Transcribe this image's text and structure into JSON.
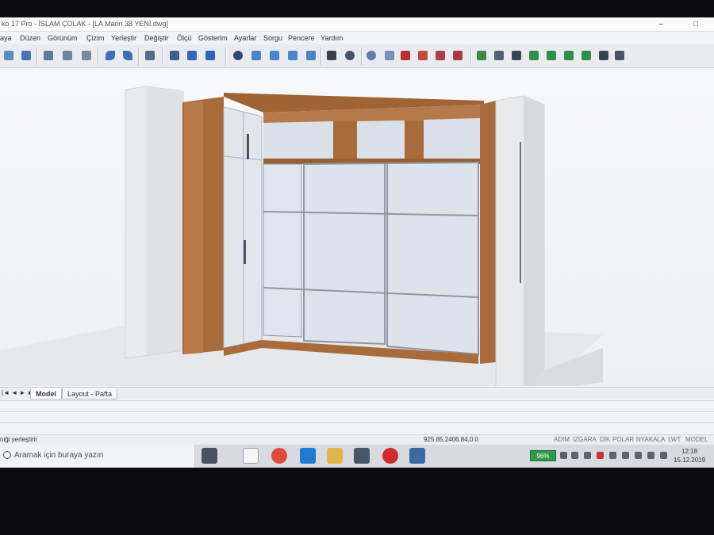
{
  "window": {
    "title": "ko 17 Pro - İSLAM ÇOLAK - [LA Marin 38 YENİ.dwg]",
    "controls": [
      "–",
      "□"
    ]
  },
  "menu": [
    "aya",
    "Düzen",
    "Görünüm",
    "Çizim",
    "Yerleştir",
    "Değiştir",
    "Ölçü",
    "Gösterim",
    "Ayarlar",
    "Sorgu",
    "Pencere",
    "Yardım"
  ],
  "toolbar_icons": [
    "open-icon",
    "save-icon",
    "print-icon",
    "undo-icon",
    "redo-icon",
    "layer-icon",
    "zoom-icon",
    "render-icon",
    "cube-icon",
    "wall-icon",
    "cabinet-icon",
    "settings-icon"
  ],
  "layout_tabs": {
    "nav": "|◄ ◄ ► ►|",
    "model": "Model",
    "layout": "Layout - Pafta"
  },
  "status": {
    "prompt": "niği yerleştirir",
    "coords": "925.85,2406.84,0.0",
    "modes": [
      "ADIM",
      "IZGARA",
      "DİK",
      "POLAR",
      "NYAKALA",
      "LWT",
      "MODEL"
    ]
  },
  "taskbar": {
    "search_placeholder": "Aramak için buraya yazın",
    "battery": "96%",
    "time": "12:18",
    "date": "15.12.2019"
  },
  "colors": {
    "wood": "#a86c3a",
    "panel": "#dde3ea",
    "frame": "#8d97a6",
    "floor": "#e7e9ec"
  }
}
